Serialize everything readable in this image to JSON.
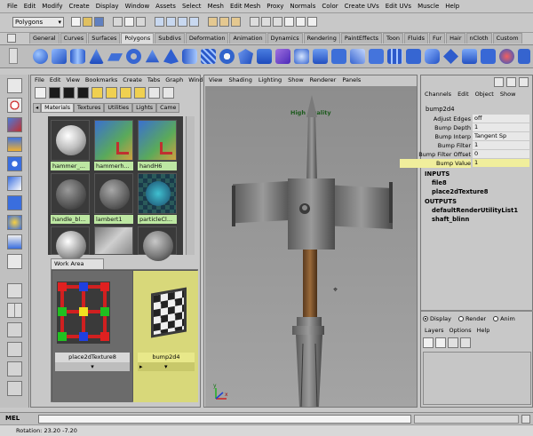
{
  "menu": [
    "File",
    "Edit",
    "Modify",
    "Create",
    "Display",
    "Window",
    "Assets",
    "Select",
    "Mesh",
    "Edit Mesh",
    "Proxy",
    "Normals",
    "Color",
    "Create UVs",
    "Edit UVs",
    "Muscle",
    "Help"
  ],
  "mode_selector": "Polygons",
  "shelf_tabs": [
    "General",
    "Curves",
    "Surfaces",
    "Polygons",
    "Subdivs",
    "Deformation",
    "Animation",
    "Dynamics",
    "Rendering",
    "PaintEffects",
    "Toon",
    "Fluids",
    "Fur",
    "Hair",
    "nCloth",
    "Custom"
  ],
  "active_shelf_tab": "Polygons",
  "hypershade": {
    "menu": [
      "File",
      "Edit",
      "View",
      "Bookmarks",
      "Create",
      "Tabs",
      "Graph",
      "Windo"
    ],
    "tabs": [
      "Materials",
      "Textures",
      "Utilities",
      "Lights",
      "Came"
    ],
    "swatches": [
      "hammer_...",
      "hammerh...",
      "handH6",
      "handle_bl...",
      "lambert1",
      "particleCl..."
    ],
    "work_area_tab": "Work Area",
    "nodes": [
      "place2dTexture8",
      "bump2d4"
    ]
  },
  "viewport": {
    "menu": [
      "View",
      "Shading",
      "Lighting",
      "Show",
      "Renderer",
      "Panels"
    ],
    "label": "High Quality",
    "axis": {
      "x": "x",
      "y": "y"
    }
  },
  "channel_box": {
    "header": [
      "Channels",
      "Edit",
      "Object",
      "Show"
    ],
    "node": "bump2d4",
    "attributes": [
      {
        "label": "Adjust Edges",
        "value": "off"
      },
      {
        "label": "Bump Depth",
        "value": "1"
      },
      {
        "label": "Bump Interp",
        "value": "Tangent Sp"
      },
      {
        "label": "Bump Filter",
        "value": "1"
      },
      {
        "label": "Bump Filter Offset",
        "value": "0"
      },
      {
        "label": "Bump Value",
        "value": "1"
      }
    ],
    "inputs_title": "INPUTS",
    "inputs": [
      "file8",
      "place2dTexture8"
    ],
    "outputs_title": "OUTPUTS",
    "outputs": [
      "defaultRenderUtilityList1",
      "shaft_blinn"
    ]
  },
  "layer_editor": {
    "radios": [
      "Display",
      "Render",
      "Anim"
    ],
    "selected": "Display",
    "menu": [
      "Layers",
      "Options",
      "Help"
    ]
  },
  "command_line": {
    "label": "MEL",
    "value": ""
  },
  "help_line": "Rotation:  23.20   -7.20"
}
